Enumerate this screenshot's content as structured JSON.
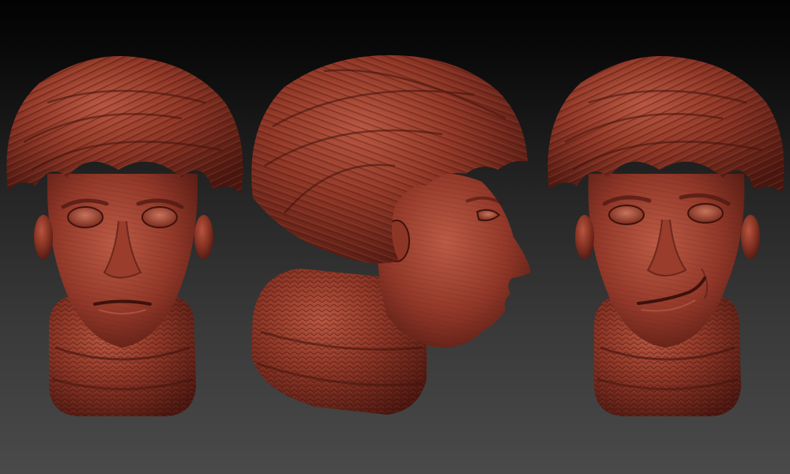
{
  "scene": {
    "description_label": "",
    "views": [
      {
        "name": "front",
        "expression": "neutral"
      },
      {
        "name": "profile-right",
        "expression": "neutral"
      },
      {
        "name": "front",
        "expression": "smirk"
      }
    ]
  },
  "colors": {
    "background_top": "#020202",
    "background_bottom": "#4a4a4a",
    "clay_base": "#8a3324",
    "clay_light": "#b0503a",
    "clay_dark": "#4a160f"
  }
}
